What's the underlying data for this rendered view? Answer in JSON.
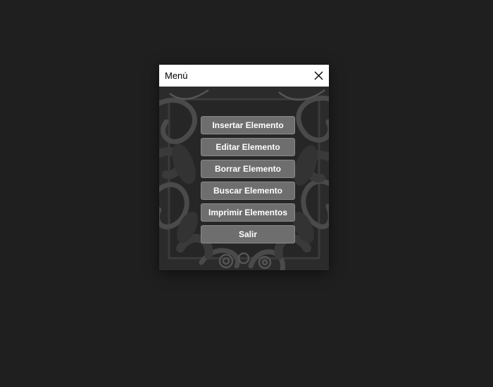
{
  "window": {
    "title": "Menú",
    "close_icon": "close-icon"
  },
  "menu": {
    "items": [
      {
        "label": "Insertar Elemento"
      },
      {
        "label": "Editar Elemento"
      },
      {
        "label": "Borrar Elemento"
      },
      {
        "label": "Buscar Elemento"
      },
      {
        "label": "Imprimir Elementos"
      },
      {
        "label": "Salir"
      }
    ]
  },
  "colors": {
    "desktop": "#1f1f1f",
    "titlebar": "#ffffff",
    "button": "#6e6e6e",
    "button_text": "#ffffff",
    "background_pattern": "#2a2a2a"
  }
}
